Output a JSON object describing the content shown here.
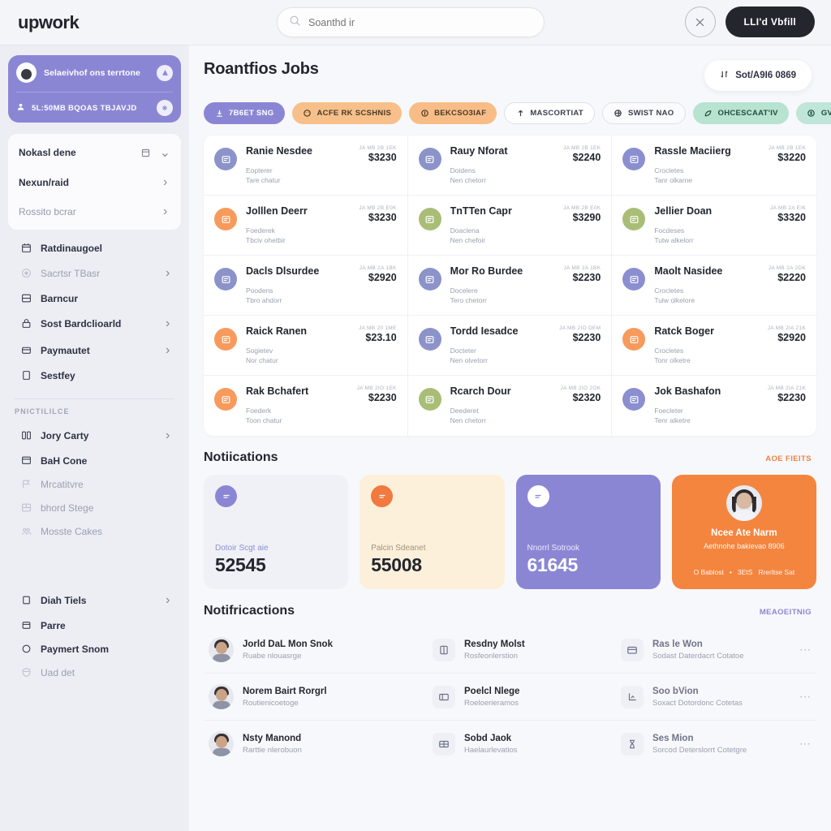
{
  "topbar": {
    "logo": "upwork",
    "search_placeholder": "Soanthd ir",
    "search_value": "",
    "close_label": "✕",
    "primary_button": "LLI'd Vbfill"
  },
  "sidebar": {
    "user_card": {
      "name": "Selaeivhof ons terrtone",
      "badge_label": "5L:50MB BQOAS TBJAVJD"
    },
    "menu_card": [
      {
        "label": "Nokasl dene",
        "icon": "grid-icon",
        "chevron": "⌄",
        "muted": false
      },
      {
        "label": "Nexun/raid",
        "icon": "none",
        "chevron": "›",
        "muted": false
      },
      {
        "label": "Rossito bcrar",
        "icon": "none",
        "chevron": "›",
        "muted": true
      }
    ],
    "nav_items": [
      {
        "label": "Ratdinaugoel",
        "icon": "calendar-icon",
        "chevron": "",
        "muted": false
      },
      {
        "label": "Sacrtsr TBasr",
        "icon": "target-icon",
        "chevron": "›",
        "muted": true
      },
      {
        "label": "Barncur",
        "icon": "list-icon",
        "chevron": "",
        "muted": false
      },
      {
        "label": "Sost Bardclioarld",
        "icon": "lock-icon",
        "chevron": "›",
        "muted": false
      },
      {
        "label": "Paymautet",
        "icon": "wallet-icon",
        "chevron": "›",
        "muted": false
      },
      {
        "label": "Sestfey",
        "icon": "square-icon",
        "chevron": "",
        "muted": false
      }
    ],
    "section_label": "PNICTILILCE",
    "section_items": [
      {
        "label": "Jory Carty",
        "icon": "columns-icon",
        "chevron": "›",
        "muted": false
      },
      {
        "label": "BaH Cone",
        "icon": "window-icon",
        "chevron": "",
        "muted": false
      },
      {
        "label": "Mrcatitvre",
        "icon": "flag-icon",
        "chevron": "",
        "muted": true
      },
      {
        "label": "bhord Stege",
        "icon": "layout-icon",
        "chevron": "",
        "muted": true
      },
      {
        "label": "Mosste Cakes",
        "icon": "users-icon",
        "chevron": "",
        "muted": true
      }
    ],
    "bottom_items": [
      {
        "label": "Diah Tiels",
        "icon": "square-icon",
        "chevron": "›",
        "muted": false
      },
      {
        "label": "Parre",
        "icon": "window-icon",
        "chevron": "",
        "muted": false
      },
      {
        "label": "Paymert Snom",
        "icon": "circle-icon",
        "chevron": "",
        "muted": false
      },
      {
        "label": "Uad det",
        "icon": "shield-icon",
        "chevron": "",
        "muted": true
      }
    ]
  },
  "main": {
    "page_title": "Roantfios Jobs",
    "sort_button": "Sot/A9I6 0869",
    "chips": [
      {
        "label": "7B6ET SNG",
        "icon": "download-icon",
        "bg": "#8b86d4",
        "fg": "#ffffff",
        "border": ""
      },
      {
        "label": "ACFE RK SCSHNIS",
        "icon": "smile-icon",
        "bg": "#f7c08a",
        "fg": "#4a3a28",
        "border": ""
      },
      {
        "label": "BEKCSO3IAF",
        "icon": "coin-icon",
        "bg": "#f8bd86",
        "fg": "#4a3a28",
        "border": ""
      },
      {
        "label": "MASCORTIAT",
        "icon": "arrow-up-icon",
        "bg": "#ffffff",
        "fg": "#3b3f4d",
        "border": "#dde1ea"
      },
      {
        "label": "SWIST NAO",
        "icon": "globe-icon",
        "bg": "#fbfbfd",
        "fg": "#3b3f4d",
        "border": "#dde1ea"
      },
      {
        "label": "OHCESCAAT'IV",
        "icon": "leaf-icon",
        "bg": "#b7e3d0",
        "fg": "#1f4d3c",
        "border": ""
      },
      {
        "label": "GVEEICQMITS",
        "icon": "dollar-icon",
        "bg": "#bfe6d8",
        "fg": "#1f4d3c",
        "border": ""
      }
    ],
    "jobs": [
      {
        "title": "Ranie Nesdee",
        "date": "JA MB 2B 1EK",
        "price": "$3230",
        "sub1": "Eopterer",
        "sub2": "Tare chatur",
        "icon_bg": "#8b93c9"
      },
      {
        "title": "Rauy Nforat",
        "date": "JA MB 2B 1EK",
        "price": "$2240",
        "sub1": "Doidens",
        "sub2": "Nen chetorr",
        "icon_bg": "#8b93c9"
      },
      {
        "title": "Rassle Maciierg",
        "date": "JA MB 2B 1EK",
        "price": "$3220",
        "sub1": "Crocletes",
        "sub2": "Tanr olkarne",
        "icon_bg": "#8b8fd0"
      },
      {
        "title": "Jolllen Deerr",
        "date": "JA MB 2B E0K",
        "price": "$3230",
        "sub1": "Foederek",
        "sub2": "Tbciv ohetbir",
        "icon_bg": "#f79a5c"
      },
      {
        "title": "TnTTen Capr",
        "date": "JA MB 2B E0K",
        "price": "$3290",
        "sub1": "Doaclena",
        "sub2": "Nen chefoir",
        "icon_bg": "#a9bd77"
      },
      {
        "title": "Jellier Doan",
        "date": "JA MB 2A EIK",
        "price": "$3320",
        "sub1": "Focdeses",
        "sub2": "Tutw alkelorr",
        "icon_bg": "#a9bd77"
      },
      {
        "title": "Dacls Dlsurdee",
        "date": "JA MB 2A 1BK",
        "price": "$2920",
        "sub1": "Poodens",
        "sub2": "Tbro ahdorr",
        "icon_bg": "#8b93c9"
      },
      {
        "title": "Mor Ro Burdee",
        "date": "JA MB 2A 1BK",
        "price": "$2230",
        "sub1": "Docelere",
        "sub2": "Tero chetorr",
        "icon_bg": "#8b93c9"
      },
      {
        "title": "Maolt Nasidee",
        "date": "JA MB 2A 2DK",
        "price": "$2220",
        "sub1": "Crocletes",
        "sub2": "Tulw olkelore",
        "icon_bg": "#8b8fd0"
      },
      {
        "title": "Raick Ranen",
        "date": "JA MB 20 1ME",
        "price": "$23.10",
        "sub1": "Sogietev",
        "sub2": "Nor chatur",
        "icon_bg": "#f79a5c"
      },
      {
        "title": "Tordd Iesadce",
        "date": "JA MB 2IO DEM",
        "price": "$2230",
        "sub1": "Docteter",
        "sub2": "Nen olvetorr",
        "icon_bg": "#8b93c9"
      },
      {
        "title": "Ratck Boger",
        "date": "JA MB 2IA 21K",
        "price": "$2920",
        "sub1": "Crocletes",
        "sub2": "Tonr olketre",
        "icon_bg": "#f79a5c"
      },
      {
        "title": "Rak Bchafert",
        "date": "JA MB 2IO 1EK",
        "price": "$2230",
        "sub1": "Foederk",
        "sub2": "Toon chatur",
        "icon_bg": "#f79a5c"
      },
      {
        "title": "Rcarch Dour",
        "date": "JA MB 2IO 2OK",
        "price": "$2320",
        "sub1": "Deederet",
        "sub2": "Nen chetorr",
        "icon_bg": "#a9bd77"
      },
      {
        "title": "Jok Bashafon",
        "date": "JA MB 2IA 21K",
        "price": "$2230",
        "sub1": "Foecleter",
        "sub2": "Tenr alketre",
        "icon_bg": "#8b8fd0"
      }
    ],
    "stats_section": {
      "title": "Notiications",
      "link": "AOE FIEITS",
      "link_color": "#ef8240"
    },
    "stats": [
      {
        "label": "Dotoir Scgt aie",
        "value": "52545",
        "bg": "#f0f1f6",
        "fg": "#23262f",
        "label_fg": "#8e8fd4",
        "icon_bg": "#8b86d4",
        "icon_fg": "#ffffff"
      },
      {
        "label": "Palcin Sdeanet",
        "value": "55008",
        "bg": "#fdf0da",
        "fg": "#23262f",
        "label_fg": "#9b9480",
        "icon_bg": "#f2793f",
        "icon_fg": "#ffffff"
      },
      {
        "label": "Nnorrl Sotrook",
        "value": "61645",
        "bg": "#8b86d4",
        "fg": "#ffffff",
        "label_fg": "#ece9fb",
        "icon_bg": "#ffffff",
        "icon_fg": "#8b86d4"
      }
    ],
    "profile_card": {
      "bg": "#f4853f",
      "name": "Ncee Ate Narm",
      "desc": "Aethnohe bakievao 8906",
      "meta": [
        "O Bablost",
        "•",
        "3EtS",
        "Rrerltse Sat"
      ]
    },
    "notif_section": {
      "title": "Notifricactions",
      "link": "MEAOEITNIG",
      "link_color": "#8b86d4"
    },
    "notifications": [
      {
        "avatar_title": "Jorld DaL Mon Snok",
        "avatar_sub": "Ruabe nlouasrge",
        "c2_icon": "book-icon",
        "c2_title": "Resdny Molst",
        "c2_sub": "Rosfeonlerstion",
        "c3_icon": "card-icon",
        "c3_title": "Ras le Won",
        "c3_sub": "Sodast Daterdacrt Cotatoe",
        "dots": "⋯"
      },
      {
        "avatar_title": "Norem Bairt Rorgrl",
        "avatar_sub": "Routienicoetoge",
        "c2_icon": "panel-icon",
        "c2_title": "Poelcl Nlege",
        "c2_sub": "Roeloerieramos",
        "c3_icon": "chart-icon",
        "c3_title": "Soo bVion",
        "c3_sub": "Soxact Dotordonc Cotetas",
        "dots": "⋯"
      },
      {
        "avatar_title": "Nsty Manond",
        "avatar_sub": "Rarttie nlerobuon",
        "c2_icon": "table-icon",
        "c2_title": "Sobd Jaok",
        "c2_sub": "Haelaurlevatios",
        "c3_icon": "hourglass-icon",
        "c3_title": "Ses Mion",
        "c3_sub": "Sorcod Deterslorrt Cotetgre",
        "dots": "⋯"
      }
    ]
  }
}
